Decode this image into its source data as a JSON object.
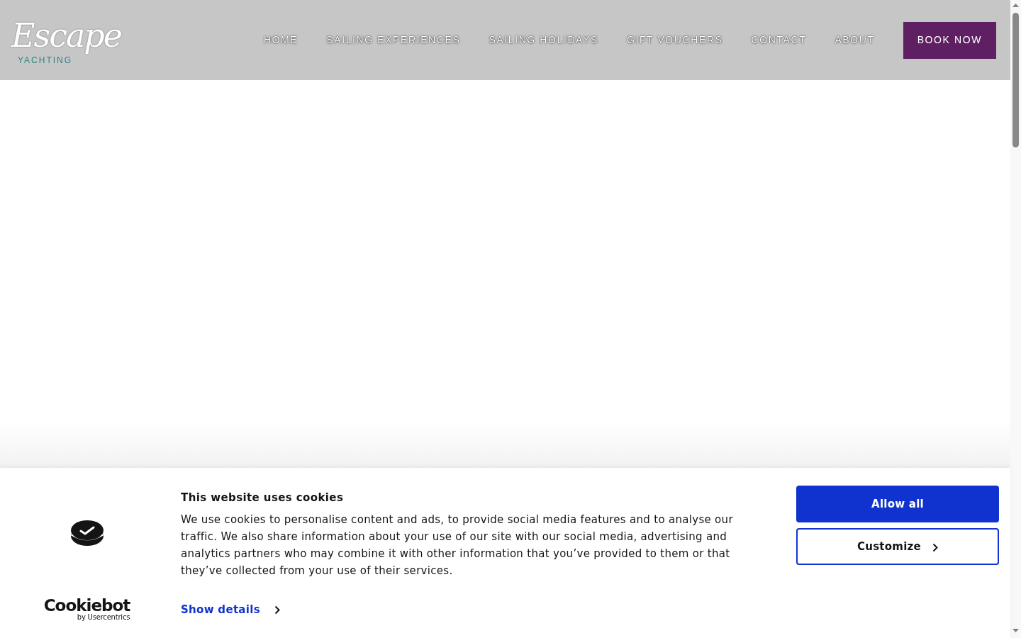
{
  "header": {
    "logo": {
      "wordmark": "Escape",
      "tagline": "YACHTING"
    },
    "nav": [
      {
        "label": "HOME"
      },
      {
        "label": "SAILING EXPERIENCES"
      },
      {
        "label": "SAILING HOLIDAYS"
      },
      {
        "label": "GIFT VOUCHERS"
      },
      {
        "label": "CONTACT"
      },
      {
        "label": "ABOUT"
      }
    ],
    "book_button": "BOOK NOW"
  },
  "cookie_banner": {
    "brand": {
      "name": "Cookiebot",
      "byline": "by Usercentrics"
    },
    "title": "This website uses cookies",
    "body": "We use cookies to personalise content and ads, to provide social media features and to analyse our traffic. We also share information about your use of our site with our social media, advertising and analytics partners who may combine it with other information that you’ve provided to them or that they’ve collected from your use of their services.",
    "details_link": "Show details",
    "buttons": [
      {
        "label": "Allow all",
        "kind": "primary"
      },
      {
        "label": "Customize",
        "kind": "secondary"
      }
    ]
  }
}
